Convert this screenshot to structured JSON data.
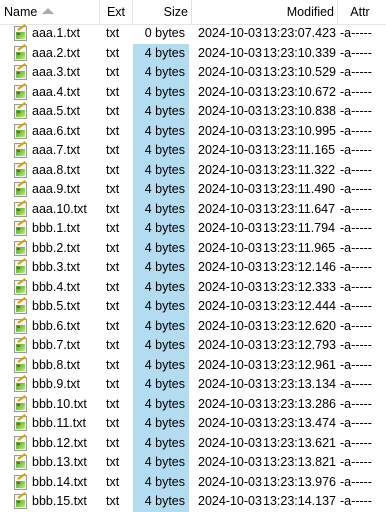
{
  "header": {
    "name": "Name",
    "ext": "Ext",
    "size": "Size",
    "modified": "Modified",
    "attr": "Attr"
  },
  "colors": {
    "size_highlight": "#b4dcf0"
  },
  "files": [
    {
      "name": "aaa.1.txt",
      "ext": "txt",
      "size": "0 bytes",
      "date": "2024-10-03",
      "time": "13:23:07.423",
      "attr": "-a-----",
      "icon": "text-file-icon"
    },
    {
      "name": "aaa.2.txt",
      "ext": "txt",
      "size": "4 bytes",
      "date": "2024-10-03",
      "time": "13:23:10.339",
      "attr": "-a-----",
      "icon": "text-file-icon"
    },
    {
      "name": "aaa.3.txt",
      "ext": "txt",
      "size": "4 bytes",
      "date": "2024-10-03",
      "time": "13:23:10.529",
      "attr": "-a-----",
      "icon": "text-file-icon"
    },
    {
      "name": "aaa.4.txt",
      "ext": "txt",
      "size": "4 bytes",
      "date": "2024-10-03",
      "time": "13:23:10.672",
      "attr": "-a-----",
      "icon": "text-file-icon"
    },
    {
      "name": "aaa.5.txt",
      "ext": "txt",
      "size": "4 bytes",
      "date": "2024-10-03",
      "time": "13:23:10.838",
      "attr": "-a-----",
      "icon": "text-file-icon"
    },
    {
      "name": "aaa.6.txt",
      "ext": "txt",
      "size": "4 bytes",
      "date": "2024-10-03",
      "time": "13:23:10.995",
      "attr": "-a-----",
      "icon": "text-file-icon"
    },
    {
      "name": "aaa.7.txt",
      "ext": "txt",
      "size": "4 bytes",
      "date": "2024-10-03",
      "time": "13:23:11.165",
      "attr": "-a-----",
      "icon": "text-file-icon"
    },
    {
      "name": "aaa.8.txt",
      "ext": "txt",
      "size": "4 bytes",
      "date": "2024-10-03",
      "time": "13:23:11.322",
      "attr": "-a-----",
      "icon": "text-file-icon"
    },
    {
      "name": "aaa.9.txt",
      "ext": "txt",
      "size": "4 bytes",
      "date": "2024-10-03",
      "time": "13:23:11.490",
      "attr": "-a-----",
      "icon": "text-file-icon"
    },
    {
      "name": "aaa.10.txt",
      "ext": "txt",
      "size": "4 bytes",
      "date": "2024-10-03",
      "time": "13:23:11.647",
      "attr": "-a-----",
      "icon": "text-file-icon"
    },
    {
      "name": "bbb.1.txt",
      "ext": "txt",
      "size": "4 bytes",
      "date": "2024-10-03",
      "time": "13:23:11.794",
      "attr": "-a-----",
      "icon": "text-file-icon"
    },
    {
      "name": "bbb.2.txt",
      "ext": "txt",
      "size": "4 bytes",
      "date": "2024-10-03",
      "time": "13:23:11.965",
      "attr": "-a-----",
      "icon": "text-file-icon"
    },
    {
      "name": "bbb.3.txt",
      "ext": "txt",
      "size": "4 bytes",
      "date": "2024-10-03",
      "time": "13:23:12.146",
      "attr": "-a-----",
      "icon": "text-file-icon"
    },
    {
      "name": "bbb.4.txt",
      "ext": "txt",
      "size": "4 bytes",
      "date": "2024-10-03",
      "time": "13:23:12.333",
      "attr": "-a-----",
      "icon": "text-file-icon"
    },
    {
      "name": "bbb.5.txt",
      "ext": "txt",
      "size": "4 bytes",
      "date": "2024-10-03",
      "time": "13:23:12.444",
      "attr": "-a-----",
      "icon": "text-file-icon"
    },
    {
      "name": "bbb.6.txt",
      "ext": "txt",
      "size": "4 bytes",
      "date": "2024-10-03",
      "time": "13:23:12.620",
      "attr": "-a-----",
      "icon": "text-file-icon"
    },
    {
      "name": "bbb.7.txt",
      "ext": "txt",
      "size": "4 bytes",
      "date": "2024-10-03",
      "time": "13:23:12.793",
      "attr": "-a-----",
      "icon": "text-file-icon"
    },
    {
      "name": "bbb.8.txt",
      "ext": "txt",
      "size": "4 bytes",
      "date": "2024-10-03",
      "time": "13:23:12.961",
      "attr": "-a-----",
      "icon": "text-file-icon"
    },
    {
      "name": "bbb.9.txt",
      "ext": "txt",
      "size": "4 bytes",
      "date": "2024-10-03",
      "time": "13:23:13.134",
      "attr": "-a-----",
      "icon": "text-file-icon"
    },
    {
      "name": "bbb.10.txt",
      "ext": "txt",
      "size": "4 bytes",
      "date": "2024-10-03",
      "time": "13:23:13.286",
      "attr": "-a-----",
      "icon": "text-file-icon"
    },
    {
      "name": "bbb.11.txt",
      "ext": "txt",
      "size": "4 bytes",
      "date": "2024-10-03",
      "time": "13:23:13.474",
      "attr": "-a-----",
      "icon": "text-file-icon"
    },
    {
      "name": "bbb.12.txt",
      "ext": "txt",
      "size": "4 bytes",
      "date": "2024-10-03",
      "time": "13:23:13.621",
      "attr": "-a-----",
      "icon": "text-file-icon"
    },
    {
      "name": "bbb.13.txt",
      "ext": "txt",
      "size": "4 bytes",
      "date": "2024-10-03",
      "time": "13:23:13.821",
      "attr": "-a-----",
      "icon": "text-file-icon"
    },
    {
      "name": "bbb.14.txt",
      "ext": "txt",
      "size": "4 bytes",
      "date": "2024-10-03",
      "time": "13:23:13.976",
      "attr": "-a-----",
      "icon": "text-file-icon"
    },
    {
      "name": "bbb.15.txt",
      "ext": "txt",
      "size": "4 bytes",
      "date": "2024-10-03",
      "time": "13:23:14.137",
      "attr": "-a-----",
      "icon": "text-file-icon"
    }
  ]
}
